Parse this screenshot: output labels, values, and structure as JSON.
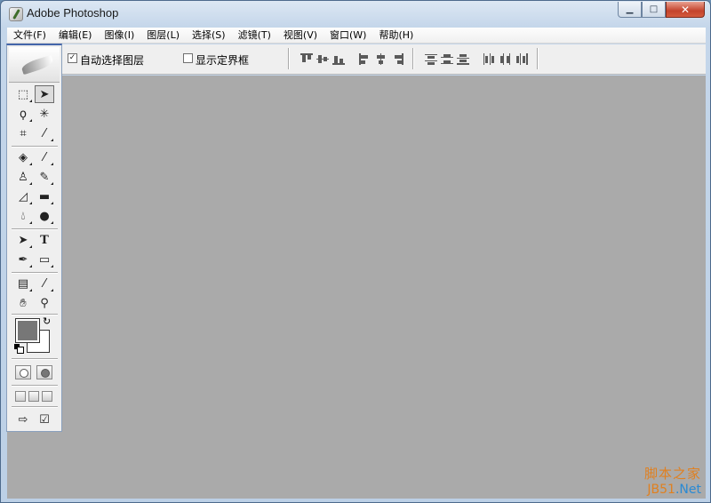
{
  "window": {
    "title": "Adobe Photoshop"
  },
  "menu": [
    {
      "label": "文件(F)"
    },
    {
      "label": "编辑(E)"
    },
    {
      "label": "图像(I)"
    },
    {
      "label": "图层(L)"
    },
    {
      "label": "选择(S)"
    },
    {
      "label": "滤镜(T)"
    },
    {
      "label": "视图(V)"
    },
    {
      "label": "窗口(W)"
    },
    {
      "label": "帮助(H)"
    }
  ],
  "options": {
    "auto_select_label": "自动选择图层",
    "auto_select_checked": true,
    "show_bounds_label": "显示定界框",
    "show_bounds_checked": false
  },
  "toolbox": {
    "tools": [
      {
        "icon": "rect-marquee-icon"
      },
      {
        "icon": "move-tool-icon",
        "active": true
      },
      {
        "icon": "lasso-icon"
      },
      {
        "icon": "magic-wand-icon"
      },
      {
        "icon": "crop-icon"
      },
      {
        "icon": "slice-icon"
      },
      {
        "icon": "healing-brush-icon"
      },
      {
        "icon": "brush-icon"
      },
      {
        "icon": "clone-stamp-icon"
      },
      {
        "icon": "history-brush-icon"
      },
      {
        "icon": "eraser-icon"
      },
      {
        "icon": "gradient-icon"
      },
      {
        "icon": "blur-icon"
      },
      {
        "icon": "dodge-icon"
      },
      {
        "icon": "path-select-icon"
      },
      {
        "icon": "type-tool-icon",
        "text": "T"
      },
      {
        "icon": "pen-icon"
      },
      {
        "icon": "rectangle-shape-icon"
      },
      {
        "icon": "notes-icon"
      },
      {
        "icon": "eyedropper-icon"
      },
      {
        "icon": "hand-icon"
      },
      {
        "icon": "zoom-icon"
      }
    ],
    "foreground_color": "#777777",
    "background_color": "#ffffff"
  },
  "colors": {
    "workspace": "#aaaaaa",
    "title_bar": "#c4d6ea",
    "close_button": "#c4432c"
  },
  "watermark": {
    "line1": "脚本之家",
    "line2_a": "JB51",
    "line2_b": ".Net"
  }
}
